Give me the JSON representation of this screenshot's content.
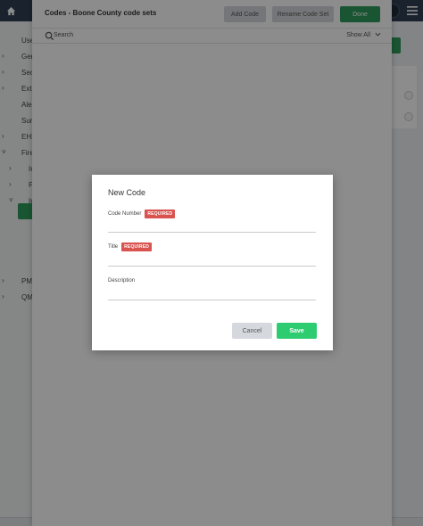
{
  "background": {
    "sidebar": [
      {
        "label": "Use",
        "chev": false
      },
      {
        "label": "Gen",
        "chev": true
      },
      {
        "label": "Secu",
        "chev": true
      },
      {
        "label": "Extr",
        "chev": true
      },
      {
        "label": "Aler",
        "chev": false
      },
      {
        "label": "Sun",
        "chev": false
      },
      {
        "label": "EHR",
        "chev": true
      },
      {
        "label": "Fire",
        "chev": "down"
      },
      {
        "label": "In",
        "chev": true
      },
      {
        "label": "P",
        "chev": true
      },
      {
        "label": "In",
        "chev": "down"
      },
      {
        "label": "PM",
        "chev": true
      },
      {
        "label": "QM",
        "chev": true
      }
    ]
  },
  "panel": {
    "title": "Codes - Boone County code sets",
    "add_code": "Add Code",
    "rename": "Rename Code Set",
    "done": "Done",
    "search_placeholder": "Search",
    "show_all": "Show All"
  },
  "modal": {
    "title": "New Code",
    "code_number_label": "Code Number",
    "title_label": "Title",
    "description_label": "Description",
    "required_badge": "REQUIRED",
    "code_number_value": "",
    "title_value": "",
    "description_value": "",
    "cancel": "Cancel",
    "save": "Save"
  },
  "colors": {
    "topbar": "#2f3f53",
    "primary_green": "#2e9c5b",
    "save_green": "#2ecc71",
    "required_red": "#d9534f"
  },
  "icons": [
    "home-icon",
    "hamburger-menu-icon",
    "search-icon",
    "chevron-down-icon",
    "chevron-right-icon"
  ]
}
